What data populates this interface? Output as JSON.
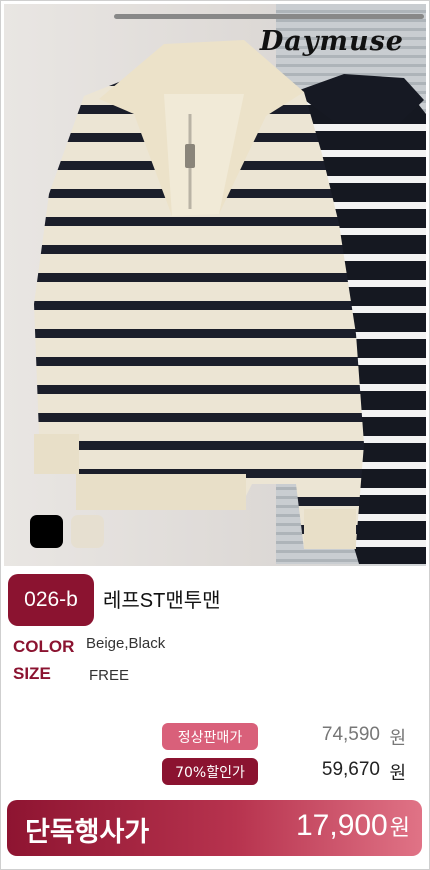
{
  "brand": "Daymuse",
  "product": {
    "code": "026-b",
    "name": "레프ST맨투맨",
    "color_label": "COLOR",
    "color_value": "Beige,Black",
    "size_label": "SIZE",
    "size_value": "FREE",
    "swatches": [
      "#000000",
      "#e6dfd0"
    ]
  },
  "pricing": {
    "regular_label": "정상판매가",
    "regular_price": "74,590",
    "regular_unit": "원",
    "discount_label": "70%할인가",
    "discount_price": "59,670",
    "discount_unit": "원",
    "exclusive_label": "단독행사가",
    "exclusive_price": "17,900",
    "exclusive_unit": "원"
  },
  "colors": {
    "accent": "#8b1330",
    "pill_light": "#d9607a",
    "pill_dark": "#8b1330"
  }
}
